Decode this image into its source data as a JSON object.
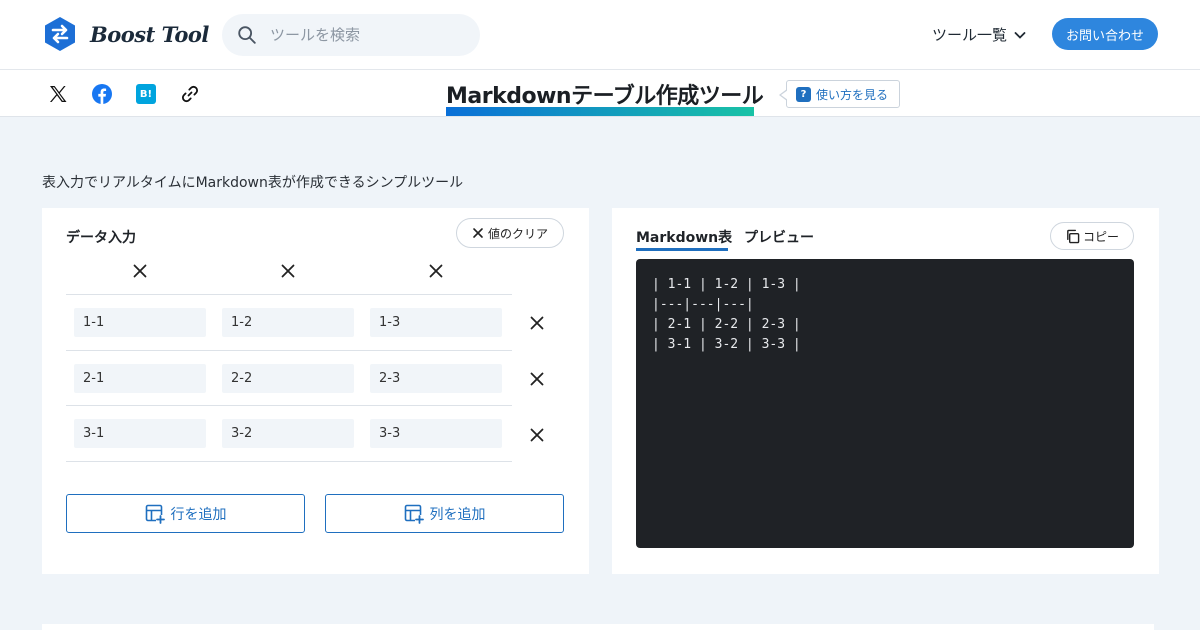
{
  "header": {
    "logo_text": "Boost Tool",
    "search_placeholder": "ツールを検索",
    "tools_menu_label": "ツール一覧",
    "contact_label": "お問い合わせ",
    "accent_color": "#2e86de"
  },
  "title_bar": {
    "share_icons": [
      "x-icon",
      "facebook-icon",
      "hatena-bookmark-icon",
      "link-icon"
    ],
    "hatena_label": "B!",
    "page_title": "Markdownテーブル作成ツール",
    "howto_badge": "?",
    "howto_label": "使い方を見る"
  },
  "description": "表入力でリアルタイムにMarkdown表が作成できるシンプルツール",
  "data_input": {
    "heading": "データ入力",
    "clear_label": "値のクリア",
    "rows": [
      [
        "1-1",
        "1-2",
        "1-3"
      ],
      [
        "2-1",
        "2-2",
        "2-3"
      ],
      [
        "3-1",
        "3-2",
        "3-3"
      ]
    ],
    "add_row_label": "行を追加",
    "add_col_label": "列を追加"
  },
  "output": {
    "tabs": [
      "Markdown表",
      "プレビュー"
    ],
    "active_tab": "Markdown表",
    "copy_label": "コピー",
    "code_lines": [
      "| 1-1 | 1-2 | 1-3 |",
      "|---|---|---|",
      "| 2-1 | 2-2 | 2-3 |",
      "| 3-1 | 3-2 | 3-3 |"
    ]
  }
}
